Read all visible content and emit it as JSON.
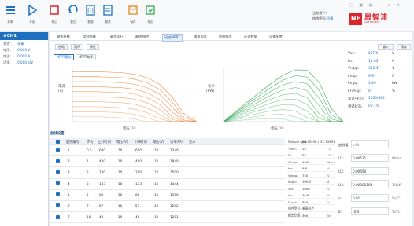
{
  "toolbar": {
    "items": [
      {
        "label": "菜单",
        "icon": "menu-icon"
      },
      {
        "label": "开始",
        "icon": "play-icon"
      },
      {
        "label": "停止",
        "icon": "stop-icon"
      },
      {
        "label": "复位",
        "icon": "reset-icon"
      },
      {
        "label": "数据",
        "icon": "data-icon"
      },
      {
        "label": "报表",
        "icon": "report-icon"
      },
      {
        "label": "保存",
        "icon": "save-icon"
      },
      {
        "label": "导出",
        "icon": "export-icon"
      }
    ],
    "user_label": "当前用户：",
    "user_name": "—",
    "change_label": "修改密码",
    "change_link": "切换",
    "window_controls": "▢ ▣ ▤ − ▫ ×",
    "logo_mark": "NF",
    "logo_name": "恩智浦",
    "logo_sub": "SOFTWARE"
  },
  "left_panel": {
    "title": "#CH1",
    "rows": [
      {
        "k": "状态:",
        "v": "采集"
      },
      {
        "k": "电压:",
        "v": "0.000 V"
      },
      {
        "k": "电流:",
        "v": "0.000 A"
      },
      {
        "k": "功率:",
        "v": "0.000 kW"
      }
    ]
  },
  "tabs": [
    "静态参数",
    "实时曲线",
    "静态运行",
    "静态MPPT",
    "动态MPPT",
    "通用测试",
    "数据报告",
    "历史数据",
    "设备配置"
  ],
  "active_tab": 4,
  "sub_buttons": [
    "启动",
    "暂停",
    "停止"
  ],
  "modes": [
    "MPPT模式",
    "MPPT效率"
  ],
  "right_buttons": [
    "输入",
    "保存"
  ],
  "chart_iv": {
    "ylabel_top": "电流",
    "ylabel_unit": "(A)",
    "xlabel": "电压 (V)"
  },
  "chart_pv": {
    "ylabel_top": "功率",
    "ylabel_unit": "(kW)",
    "xlabel": "电压 (V)"
  },
  "chart_data": [
    {
      "type": "line",
      "xlabel": "电压 (V)",
      "ylabel": "电流 (A)",
      "curves": "I-V family",
      "series_color": "#e8873d",
      "x": [
        0,
        10,
        20,
        30,
        40,
        50,
        60,
        70,
        80,
        90,
        100
      ],
      "series": [
        {
          "values": [
            10,
            10,
            10,
            9.9,
            9.8,
            9.5,
            8.8,
            7.5,
            5.0,
            1.5,
            0
          ]
        },
        {
          "values": [
            9,
            9,
            9,
            8.9,
            8.8,
            8.5,
            7.8,
            6.5,
            4.0,
            0.8,
            0
          ]
        },
        {
          "values": [
            8,
            8,
            8,
            7.9,
            7.8,
            7.5,
            6.8,
            5.5,
            3.0,
            0.3,
            0
          ]
        },
        {
          "values": [
            7,
            7,
            7,
            6.9,
            6.8,
            6.5,
            5.8,
            4.5,
            2.0,
            0,
            0
          ]
        },
        {
          "values": [
            6,
            6,
            6,
            5.9,
            5.8,
            5.5,
            4.8,
            3.5,
            1.0,
            0,
            0
          ]
        },
        {
          "values": [
            5,
            5,
            5,
            4.9,
            4.8,
            4.5,
            3.8,
            2.5,
            0.4,
            0,
            0
          ]
        },
        {
          "values": [
            4,
            4,
            4,
            3.9,
            3.8,
            3.5,
            2.8,
            1.5,
            0,
            0,
            0
          ]
        },
        {
          "values": [
            3,
            3,
            3,
            2.9,
            2.8,
            2.5,
            1.8,
            0.6,
            0,
            0,
            0
          ]
        },
        {
          "values": [
            2,
            2,
            2,
            1.9,
            1.8,
            1.5,
            0.8,
            0,
            0,
            0,
            0
          ]
        },
        {
          "values": [
            1,
            1,
            1,
            0.9,
            0.8,
            0.5,
            0,
            0,
            0,
            0,
            0
          ]
        }
      ],
      "ylim": [
        0,
        11
      ]
    },
    {
      "type": "line",
      "xlabel": "电压 (V)",
      "ylabel": "功率 (kW)",
      "curves": "P-V family",
      "series_color": "#3aa85a",
      "x": [
        0,
        10,
        20,
        30,
        40,
        50,
        60,
        70,
        80,
        90,
        100
      ],
      "series": [
        {
          "values": [
            0,
            100,
            200,
            297,
            392,
            475,
            528,
            525,
            400,
            135,
            0
          ]
        },
        {
          "values": [
            0,
            90,
            180,
            267,
            352,
            425,
            468,
            455,
            320,
            72,
            0
          ]
        },
        {
          "values": [
            0,
            80,
            160,
            237,
            312,
            375,
            408,
            385,
            240,
            27,
            0
          ]
        },
        {
          "values": [
            0,
            70,
            140,
            207,
            272,
            325,
            348,
            315,
            160,
            0,
            0
          ]
        },
        {
          "values": [
            0,
            60,
            120,
            177,
            232,
            275,
            288,
            245,
            80,
            0,
            0
          ]
        },
        {
          "values": [
            0,
            50,
            100,
            147,
            192,
            225,
            228,
            175,
            32,
            0,
            0
          ]
        },
        {
          "values": [
            0,
            40,
            80,
            117,
            152,
            175,
            168,
            105,
            0,
            0,
            0
          ]
        },
        {
          "values": [
            0,
            30,
            60,
            87,
            112,
            125,
            108,
            42,
            0,
            0,
            0
          ]
        },
        {
          "values": [
            0,
            20,
            40,
            57,
            72,
            75,
            48,
            0,
            0,
            0,
            0
          ]
        },
        {
          "values": [
            0,
            10,
            20,
            27,
            32,
            25,
            0,
            0,
            0,
            0,
            0
          ]
        }
      ],
      "ylim": [
        0,
        560
      ]
    }
  ],
  "readout": [
    {
      "k": "Voc:",
      "v": "687.9",
      "u": "V"
    },
    {
      "k": "Isc:",
      "v": "11.03",
      "u": "A"
    },
    {
      "k": "Vmpp:",
      "v": "543.37",
      "u": "V"
    },
    {
      "k": "Impp:",
      "v": "9.97",
      "u": "A"
    },
    {
      "k": "Pmpp:",
      "v": "5.40",
      "u": "kW"
    },
    {
      "k": "FF/mpp:",
      "v": "0",
      "u": "%"
    },
    {
      "k": "累计/平均:",
      "v": "1000/800",
      "u": ""
    },
    {
      "k": "测试状态:",
      "v": "0 / 1%",
      "u": ""
    }
  ],
  "table": {
    "title": "曲线设置",
    "headers": [
      "曲线编号",
      "步长",
      "上升时间",
      "电压(V)",
      "下降时间",
      "电压(V)",
      "功率(W)",
      "显示"
    ],
    "rows": [
      [
        "1",
        "0.5",
        "600",
        "10",
        "600",
        "10",
        "1340"
      ],
      [
        "2",
        "1",
        "400",
        "10",
        "400",
        "10",
        "1940"
      ],
      [
        "3",
        "2",
        "200",
        "10",
        "200",
        "10",
        "1500"
      ],
      [
        "4",
        "3",
        "133",
        "10",
        "133",
        "10",
        "1444"
      ],
      [
        "5",
        "5",
        "80",
        "10",
        "80",
        "10",
        "1300"
      ],
      [
        "6",
        "7",
        "57",
        "10",
        "57",
        "10",
        "1202"
      ],
      [
        "7",
        "10",
        "40",
        "10",
        "40",
        "10",
        "1201"
      ]
    ]
  },
  "params": [
    {
      "k": "Sample type",
      "v": "EN 50530 / IEC 62891",
      "u": ""
    },
    {
      "k": "Tmin:",
      "v": "25",
      "u": "°C"
    },
    {
      "k": "Tc:",
      "v": "25",
      "u": "°C"
    },
    {
      "k": "Gmax:",
      "v": "1000",
      "u": "W/m²"
    },
    {
      "k": "Isc:",
      "v": "9.8",
      "u": "A"
    },
    {
      "k": "Vmpp:",
      "v": "750",
      "u": "V"
    },
    {
      "k": "Impp:",
      "v": "100.9",
      "u": "A"
    },
    {
      "k": "Voc:",
      "v": "1000",
      "u": "V"
    },
    {
      "k": "Isc:",
      "v": "10.8",
      "u": "A"
    },
    {
      "k": "Pmax:",
      "v": "600",
      "u": "V"
    },
    {
      "k": "组件型号:",
      "v": "单晶硅片",
      "u": ""
    },
    {
      "k": "额定功率:",
      "v": "300",
      "u": "W"
    }
  ],
  "calc": [
    {
      "k": "曲线值:",
      "v": "c-Si",
      "u": ""
    },
    {
      "k": "U1:",
      "v": "0.00531",
      "u": "W/m²"
    },
    {
      "k": "U2:",
      "v": "0.00590",
      "u": ""
    },
    {
      "k": "U3:",
      "v": "0.00000168",
      "u": "1/V/W"
    },
    {
      "k": "α:",
      "v": "0.01",
      "u": "%/°C"
    },
    {
      "k": "β:",
      "v": "-0.4",
      "u": "%/°C"
    }
  ]
}
